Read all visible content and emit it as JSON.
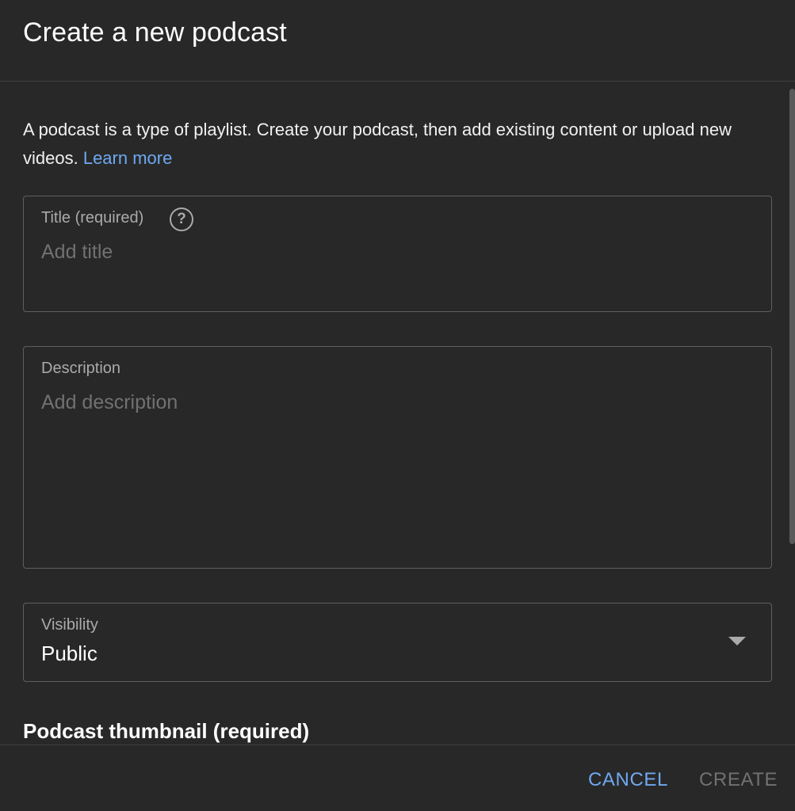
{
  "dialog": {
    "title": "Create a new podcast"
  },
  "intro": {
    "text": "A podcast is a type of playlist. Create your podcast, then add existing content or upload new videos. ",
    "link": "Learn more"
  },
  "title_field": {
    "label": "Title (required)",
    "placeholder": "Add title",
    "help_glyph": "?"
  },
  "description_field": {
    "label": "Description",
    "placeholder": "Add description"
  },
  "visibility_field": {
    "label": "Visibility",
    "value": "Public"
  },
  "thumbnail": {
    "title": "Podcast thumbnail (required)"
  },
  "footer": {
    "cancel_label": "CANCEL",
    "create_label": "CREATE"
  },
  "colors": {
    "background": "#282828",
    "accent": "#6fa8f1",
    "border": "#5f5f5f",
    "disabled": "#717171"
  },
  "icons": {
    "help": "help-circle-icon",
    "dropdown": "triangle-down-icon"
  }
}
